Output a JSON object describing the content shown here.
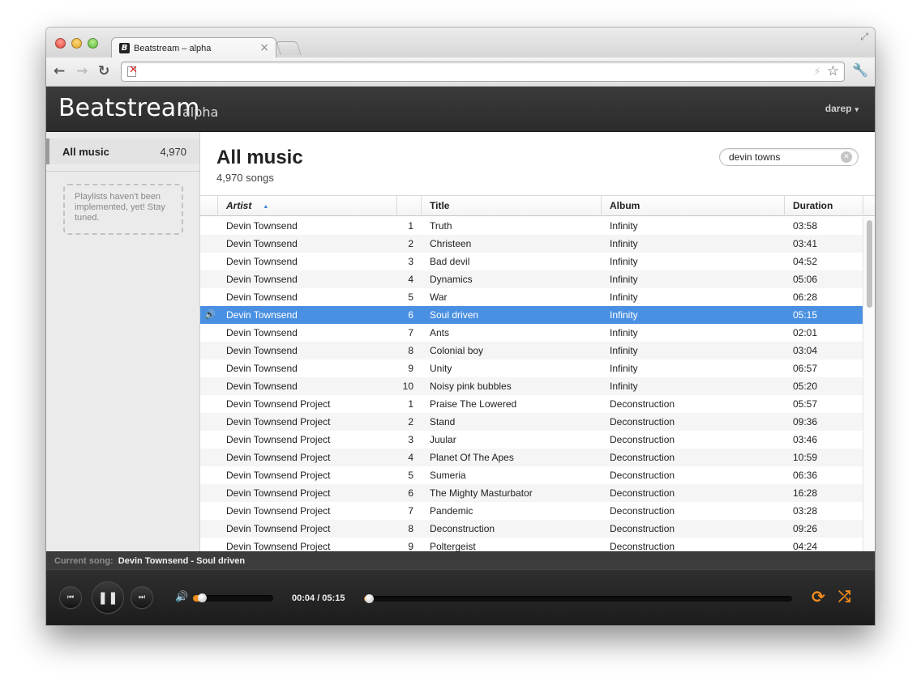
{
  "browser": {
    "tab_title": "Beatstream – alpha",
    "favicon_letter": "B",
    "icons": {
      "close_tab": "×",
      "back": "←",
      "forward": "→",
      "reload": "↻",
      "page_error": "✕",
      "bolt": "⚡",
      "star": "☆",
      "wrench": "🔧",
      "fullscreen": "⤢"
    }
  },
  "app": {
    "title": "Beatstream",
    "subtitle": "alpha",
    "user": "darep",
    "caret": "▾"
  },
  "sidebar": {
    "items": [
      {
        "label": "All music",
        "count": "4,970"
      }
    ],
    "playlist_note": "Playlists haven't been implemented, yet! Stay tuned."
  },
  "main": {
    "title": "All music",
    "subtitle": "4,970 songs",
    "search": {
      "value": "devin towns",
      "clear_icon": "✕"
    },
    "sort_icon": "▲",
    "columns": {
      "artist": "Artist",
      "track": "",
      "title": "Title",
      "album": "Album",
      "duration": "Duration"
    },
    "playing_icon": "🔊",
    "rows": [
      {
        "artist": "Devin Townsend",
        "track": "1",
        "title": "Truth",
        "album": "Infinity",
        "duration": "03:58",
        "playing": false
      },
      {
        "artist": "Devin Townsend",
        "track": "2",
        "title": "Christeen",
        "album": "Infinity",
        "duration": "03:41",
        "playing": false
      },
      {
        "artist": "Devin Townsend",
        "track": "3",
        "title": "Bad devil",
        "album": "Infinity",
        "duration": "04:52",
        "playing": false
      },
      {
        "artist": "Devin Townsend",
        "track": "4",
        "title": "Dynamics",
        "album": "Infinity",
        "duration": "05:06",
        "playing": false
      },
      {
        "artist": "Devin Townsend",
        "track": "5",
        "title": "War",
        "album": "Infinity",
        "duration": "06:28",
        "playing": false
      },
      {
        "artist": "Devin Townsend",
        "track": "6",
        "title": "Soul driven",
        "album": "Infinity",
        "duration": "05:15",
        "playing": true
      },
      {
        "artist": "Devin Townsend",
        "track": "7",
        "title": "Ants",
        "album": "Infinity",
        "duration": "02:01",
        "playing": false
      },
      {
        "artist": "Devin Townsend",
        "track": "8",
        "title": "Colonial boy",
        "album": "Infinity",
        "duration": "03:04",
        "playing": false
      },
      {
        "artist": "Devin Townsend",
        "track": "9",
        "title": "Unity",
        "album": "Infinity",
        "duration": "06:57",
        "playing": false
      },
      {
        "artist": "Devin Townsend",
        "track": "10",
        "title": "Noisy pink bubbles",
        "album": "Infinity",
        "duration": "05:20",
        "playing": false
      },
      {
        "artist": "Devin Townsend Project",
        "track": "1",
        "title": "Praise The Lowered",
        "album": "Deconstruction",
        "duration": "05:57",
        "playing": false
      },
      {
        "artist": "Devin Townsend Project",
        "track": "2",
        "title": "Stand",
        "album": "Deconstruction",
        "duration": "09:36",
        "playing": false
      },
      {
        "artist": "Devin Townsend Project",
        "track": "3",
        "title": "Juular",
        "album": "Deconstruction",
        "duration": "03:46",
        "playing": false
      },
      {
        "artist": "Devin Townsend Project",
        "track": "4",
        "title": "Planet Of The Apes",
        "album": "Deconstruction",
        "duration": "10:59",
        "playing": false
      },
      {
        "artist": "Devin Townsend Project",
        "track": "5",
        "title": "Sumeria",
        "album": "Deconstruction",
        "duration": "06:36",
        "playing": false
      },
      {
        "artist": "Devin Townsend Project",
        "track": "6",
        "title": "The Mighty Masturbator",
        "album": "Deconstruction",
        "duration": "16:28",
        "playing": false
      },
      {
        "artist": "Devin Townsend Project",
        "track": "7",
        "title": "Pandemic",
        "album": "Deconstruction",
        "duration": "03:28",
        "playing": false
      },
      {
        "artist": "Devin Townsend Project",
        "track": "8",
        "title": "Deconstruction",
        "album": "Deconstruction",
        "duration": "09:26",
        "playing": false
      },
      {
        "artist": "Devin Townsend Project",
        "track": "9",
        "title": "Poltergeist",
        "album": "Deconstruction",
        "duration": "04:24",
        "playing": false
      }
    ]
  },
  "player": {
    "current_song_label": "Current song:",
    "current_song": "Devin Townsend - Soul driven",
    "time": "00:04 / 05:15",
    "volume_level": 0.12,
    "progress_fraction": 0.013,
    "icons": {
      "prev": "⏮",
      "pause": "❚❚",
      "next": "⏭",
      "volume": "🔊",
      "repeat": "⟳",
      "shuffle": "⤮"
    },
    "accent_color": "#f28c1e"
  },
  "colors": {
    "selection": "#4a90e2",
    "header_bg": "#2f2f2f",
    "accent": "#f28c1e"
  }
}
